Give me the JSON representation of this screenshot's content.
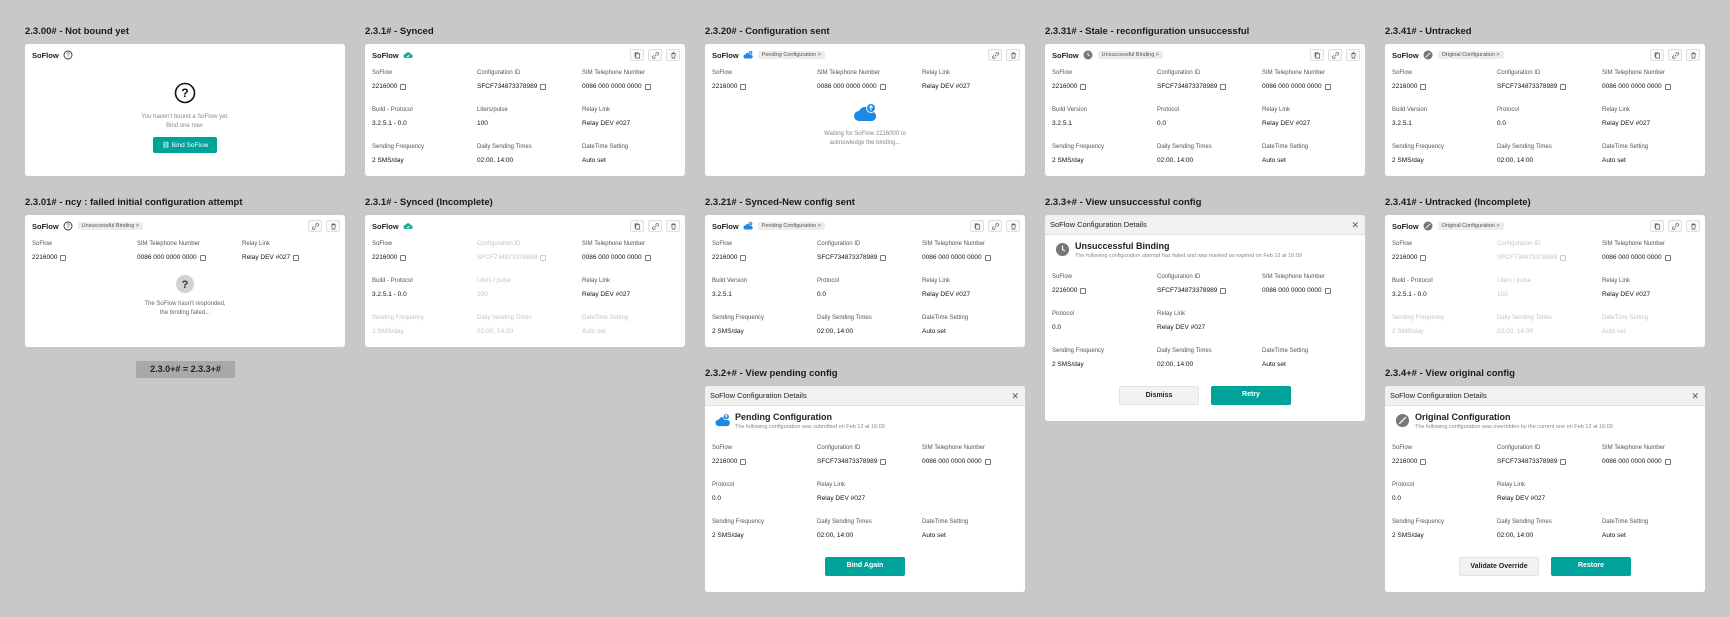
{
  "columns": {
    "c1_top": "2.3.00# - Not bound yet",
    "c1_bottom": "2.3.01# - ncy : failed initial configuration attempt",
    "c2_top": "2.3.1# - Synced",
    "c2_bottom": "2.3.1# - Synced (Incomplete)",
    "c3_top": "2.3.20# - Configuration sent",
    "c3_mid": "2.3.21# - Synced-New config sent",
    "c3_bottom": "2.3.2+# - View pending config",
    "c4_top": "2.3.31# - Stale - reconfiguration unsuccessful",
    "c4_mid": "2.3.3+# - View unsuccessful config",
    "c5_top": "2.3.41# - Untracked",
    "c5_mid": "2.3.41# - Untracked (Incomplete)",
    "c5_bottom": "2.3.4+# - View original config"
  },
  "equivalence_label": "2.3.0+#  =  2.3.3+#",
  "labels": {
    "soflow": "SoFlow",
    "config_id": "Configuration ID",
    "sim": "SIM Telephone Number",
    "relay": "Relay Link",
    "build_protocol": "Build - Protocol",
    "build_version": "Build Version",
    "protocol": "Protocol",
    "liters": "Liters/pulse",
    "liters_muted": "Liters / pulse",
    "freq": "Sending Frequency",
    "times": "Daily Sending Times",
    "datetime": "DateTime Setting"
  },
  "values": {
    "soflow_id": "2216000",
    "config_id": "SFCF734873378989",
    "sim": "0086 000 0000 0000",
    "relay": "Relay DEV #027",
    "build_protocol": "3.2.5.1 - 0.0",
    "build_version": "3.2.5.1",
    "protocol": "0.0",
    "liters": "100",
    "freq": "2 SMS/day",
    "times": "02:00, 14:00",
    "datetime": "Auto set"
  },
  "badges": {
    "pending": "Pending Configuration >",
    "unsuccessful": "Unsuccessful Binding >",
    "original": "Original Configuration >"
  },
  "not_bound": {
    "message_line1": "You haven't bound a SoFlow yet.",
    "message_line2": "Bind one now.",
    "button": "Bind SoFlow"
  },
  "failed_initial": {
    "line1": "The SoFlow hasn't responded,",
    "line2": "the binding failed..."
  },
  "waiting": {
    "line1": "Waiting for SoFlow 2216000 to",
    "line2": "acknowledge the binding..."
  },
  "dialog": {
    "title": "SoFlow Configuration Details",
    "pending_title": "Pending Configuration",
    "pending_desc": "The following configuration was submitted on Feb 12 at 16:00",
    "pending_button": "Bind Again",
    "unsuccessful_title": "Unsuccessful Binding",
    "unsuccessful_desc": "The following configuration attempt has failed and was marked as expired on Feb 12 at 16:00",
    "dismiss": "Dismiss",
    "retry": "Retry",
    "original_title": "Original Configuration",
    "original_desc": "The following configuration was overridden by the current one on Feb 12 at 16:00",
    "validate": "Validate Override",
    "restore": "Restore"
  },
  "colors": {
    "accent": "#00a39a",
    "cloud_blue": "#1e88e5",
    "background": "#c8c8c8"
  },
  "icons": [
    "help-icon",
    "cloud-check-icon",
    "cloud-upload-icon",
    "clock-icon",
    "untracked-icon",
    "copy-icon",
    "link-icon",
    "trash-icon",
    "close-icon"
  ]
}
